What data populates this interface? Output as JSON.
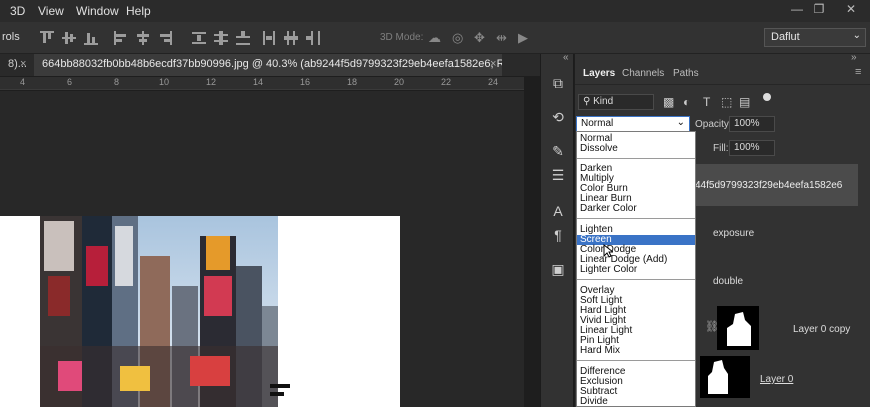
{
  "menu": {
    "items": [
      "3D",
      "View",
      "Window",
      "Help"
    ],
    "window_controls": [
      "—",
      "❐",
      "✕"
    ]
  },
  "options_bar": {
    "left_label": "rols",
    "mode_3d": "3D Mode:",
    "workspace": "Daflut"
  },
  "tabs": {
    "left_stub": "8)...",
    "left_close": "×",
    "active_title": "664bb88032fb0bb48b6ecdf37bb90996.jpg @ 40.3% (ab9244f5d9799323f29eb4eefa1582e6, RGB/8#) *",
    "active_close": "×"
  },
  "ruler": {
    "labels": [
      "4",
      "6",
      "8",
      "10",
      "12",
      "14",
      "16",
      "18",
      "20",
      "22",
      "24"
    ]
  },
  "side_strip": {
    "collapse": "«",
    "icons": [
      "history-icon",
      "actions-icon",
      "brush-icon",
      "adjustments-icon",
      "character-icon",
      "paragraph-icon",
      "libraries-icon"
    ]
  },
  "layers_panel": {
    "tabs": [
      "Layers",
      "Channels",
      "Paths"
    ],
    "kind_label": "Kind",
    "blend_mode": "Normal",
    "opacity_label": "Opacity:",
    "opacity_value": "100%",
    "fill_label": "Fill:",
    "fill_value": "100%",
    "layers": [
      {
        "name": "44f5d9799323f29eb4eefa1582e6"
      },
      {
        "name": "exposure"
      },
      {
        "name": "double"
      },
      {
        "name": "Layer 0 copy"
      },
      {
        "name": "Layer 0"
      }
    ]
  },
  "blend_list": {
    "groups": [
      [
        "Normal",
        "Dissolve"
      ],
      [
        "Darken",
        "Multiply",
        "Color Burn",
        "Linear Burn",
        "Darker Color"
      ],
      [
        "Lighten",
        "Screen",
        "Color Dodge",
        "Linear Dodge (Add)",
        "Lighter Color"
      ],
      [
        "Overlay",
        "Soft Light",
        "Hard Light",
        "Vivid Light",
        "Linear Light",
        "Pin Light",
        "Hard Mix"
      ],
      [
        "Difference",
        "Exclusion",
        "Subtract",
        "Divide"
      ]
    ],
    "selected": "Screen"
  },
  "colors": {
    "highlight": "#3a73c6",
    "panel_bg": "#323232"
  }
}
